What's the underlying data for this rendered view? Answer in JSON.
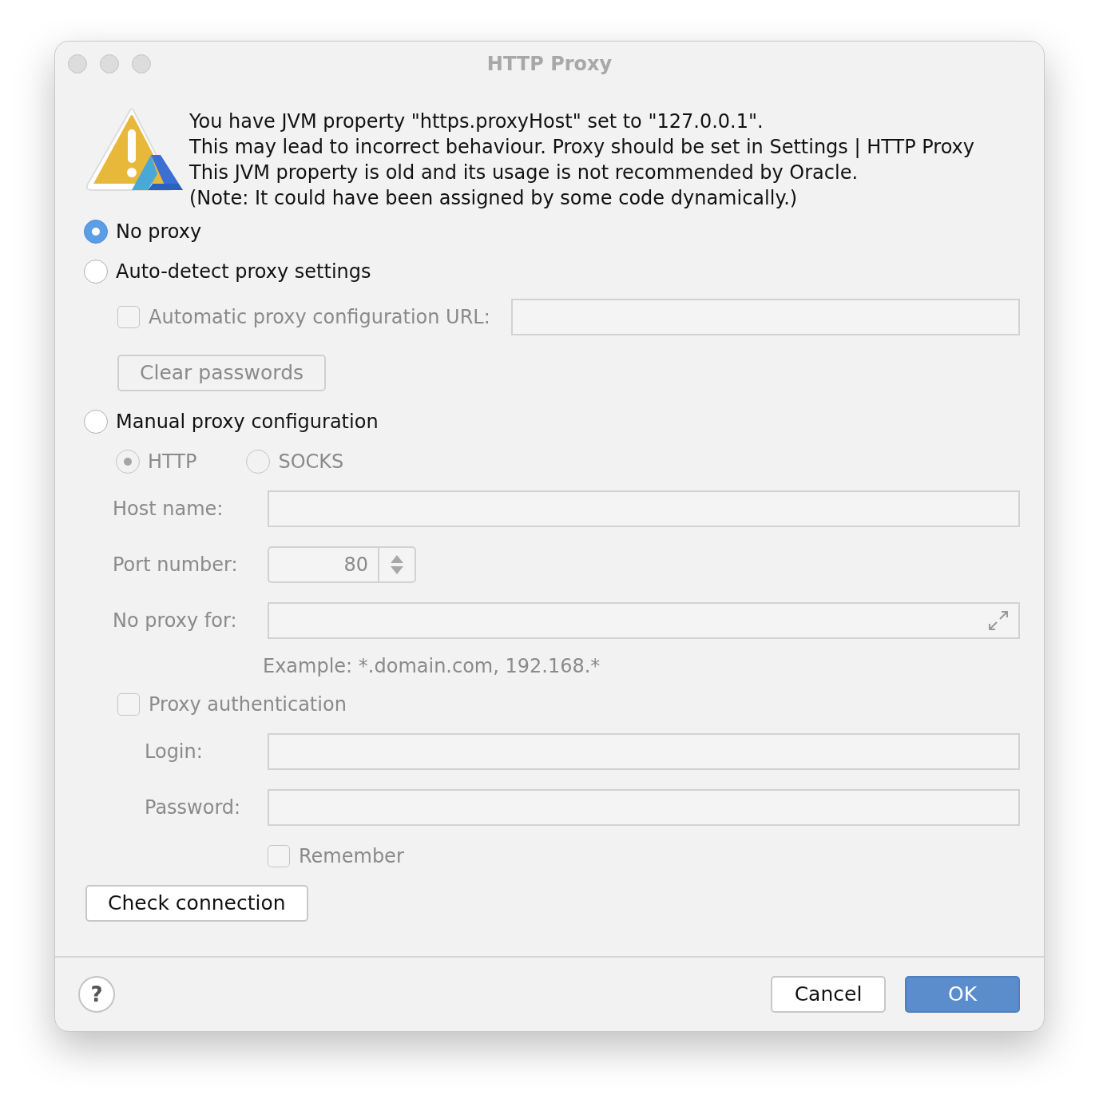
{
  "window": {
    "title": "HTTP Proxy"
  },
  "warning": {
    "lines": [
      "You have JVM property \"https.proxyHost\" set to \"127.0.0.1\".",
      "This may lead to incorrect behaviour. Proxy should be set in Settings | HTTP Proxy",
      "This JVM property is old and its usage is not recommended by Oracle.",
      "(Note: It could have been assigned by some code dynamically.)"
    ]
  },
  "proxy_modes": [
    {
      "label": "No proxy",
      "selected": true
    },
    {
      "label": "Auto-detect proxy settings",
      "selected": false
    },
    {
      "label": "Manual proxy configuration",
      "selected": false
    }
  ],
  "auto_detect": {
    "disabled": true,
    "pac_url": {
      "label": "Automatic proxy configuration URL:",
      "checked": false
    },
    "clear_passwords": "Clear passwords"
  },
  "manual": {
    "disabled": true,
    "protocols": [
      {
        "label": "HTTP",
        "selected": true
      },
      {
        "label": "SOCKS",
        "selected": false
      }
    ],
    "host": {
      "label": "Host name:"
    },
    "port": {
      "label": "Port number:",
      "value": "80"
    },
    "no_proxy_for": {
      "label": "No proxy for:"
    },
    "example": "Example: *.domain.com, 192.168.*",
    "auth": {
      "label": "Proxy authentication",
      "checked": false
    },
    "login": {
      "label": "Login:"
    },
    "password": {
      "label": "Password:"
    },
    "remember": {
      "label": "Remember",
      "checked": false
    }
  },
  "check_button": "Check connection",
  "footer": {
    "help": "?",
    "buttons": [
      {
        "label": "Cancel",
        "kind": "default"
      },
      {
        "label": "OK",
        "kind": "primary"
      }
    ]
  }
}
